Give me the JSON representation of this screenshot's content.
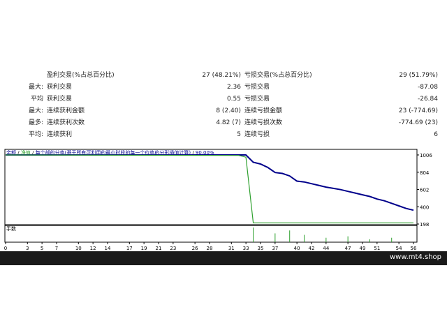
{
  "stats": {
    "rows": [
      {
        "l1": "",
        "l2": "盈利交易(%占总百分比)",
        "v1": "27 (48.21%)",
        "l3": "亏损交易(%占总百分比)",
        "v2": "29 (51.79%)"
      },
      {
        "l1": "最大:",
        "l2": "获利交易",
        "v1": "2.36",
        "l3": "亏损交易",
        "v2": "-87.08"
      },
      {
        "l1": "平均",
        "l2": "获利交易",
        "v1": "0.55",
        "l3": "亏损交易",
        "v2": "-26.84"
      },
      {
        "l1": "最大:",
        "l2": "连续获利金额",
        "v1": "8 (2.40)",
        "l3": "连续亏损金额",
        "v2": "23 (-774.69)"
      },
      {
        "l1": "最多:",
        "l2": "连续获利次数",
        "v1": "4.82 (7)",
        "l3": "连续亏损次数",
        "v2": "-774.69 (23)"
      },
      {
        "l1": "平均:",
        "l2": "连续获利",
        "v1": "5",
        "l3": "连续亏损",
        "v2": "6"
      }
    ]
  },
  "chart_header": {
    "balance": "余额",
    "equity": "净值",
    "text": "每个部的分格(基于所有可利用的最小时段的每一个价格的分形插值计算)",
    "quality": "90.00%"
  },
  "volume_label": "手数",
  "colors": {
    "balance": "#00008b",
    "equity": "#2ea02e",
    "volume": "#2ea02e"
  },
  "chart_data": {
    "type": "line",
    "y_ticks": [
      1006,
      804,
      602,
      400,
      198
    ],
    "ylim": [
      198,
      1006
    ],
    "x_ticks": [
      0,
      3,
      5,
      7,
      10,
      12,
      14,
      17,
      19,
      21,
      23,
      26,
      28,
      31,
      33,
      35,
      37,
      40,
      42,
      44,
      47,
      49,
      51,
      54,
      56
    ],
    "xlim": [
      0,
      56
    ],
    "series": [
      {
        "name": "余额",
        "x": [
          0,
          33,
          34,
          35,
          36,
          37,
          38,
          39,
          40,
          41,
          42,
          43,
          44,
          45,
          46,
          47,
          48,
          49,
          50,
          51,
          52,
          53,
          54,
          55,
          56
        ],
        "values": [
          1006,
          1006,
          920,
          900,
          860,
          800,
          790,
          760,
          700,
          690,
          670,
          650,
          630,
          615,
          600,
          580,
          560,
          540,
          520,
          490,
          470,
          440,
          410,
          380,
          360
        ]
      },
      {
        "name": "净值",
        "x": [
          0,
          32,
          33,
          34,
          56
        ],
        "values": [
          1006,
          1000,
          980,
          212,
          212
        ]
      }
    ],
    "volume": {
      "x": [
        34,
        37,
        39,
        41,
        44,
        47,
        50,
        53
      ],
      "values": [
        1.0,
        0.6,
        0.8,
        0.5,
        0.3,
        0.4,
        0.2,
        0.3
      ]
    }
  },
  "footer": {
    "site": "www.mt4.shop"
  }
}
